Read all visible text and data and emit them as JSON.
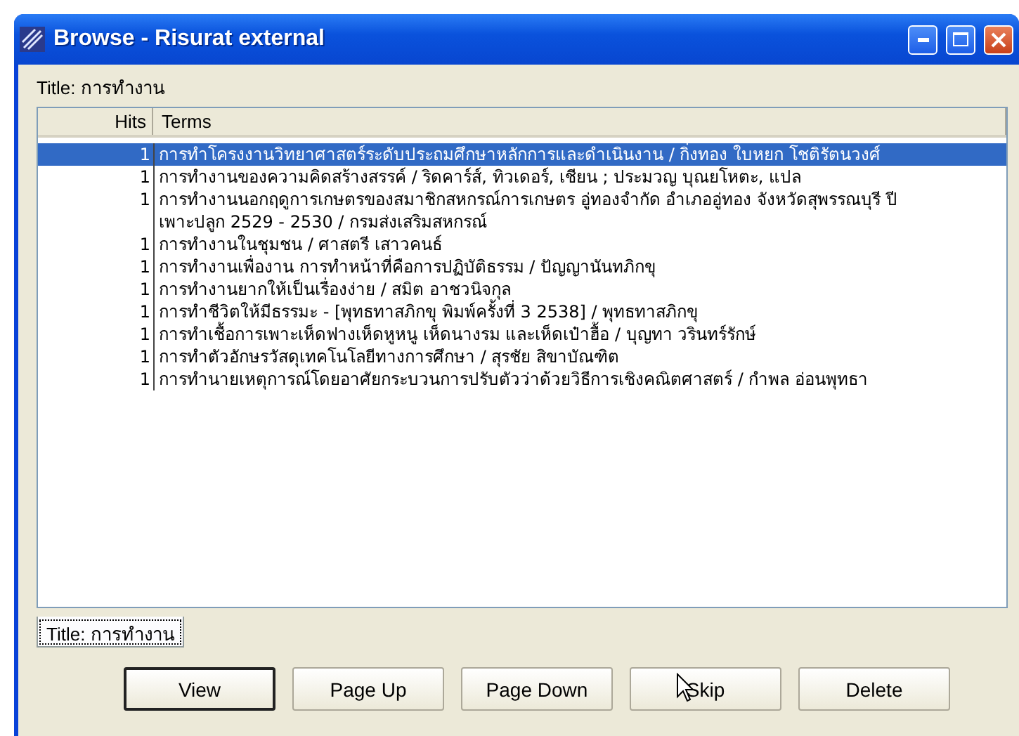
{
  "window": {
    "title": "Browse - Risurat external"
  },
  "query_label": "Title: การทำงาน",
  "table": {
    "columns": [
      "Hits",
      "Terms"
    ],
    "rows": [
      {
        "hits": "1",
        "term": "การทำโครงงานวิทยาศาสตร์ระดับประถมศึกษาหลักการและดำเนินงาน / กิ่งทอง ใบหยก โชติรัตนวงศ์",
        "selected": true
      },
      {
        "hits": "1",
        "term": "การทำงานของความคิดสร้างสรรค์ / ริดคาร์ส์, ทิวเดอร์, เชียน ; ประมวญ บุณยโหตะ, แปล",
        "selected": false
      },
      {
        "hits": "1",
        "term": "การทำงานนอกฤดูการเกษตรของสมาชิกสหกรณ์การเกษตร อู่ทองจำกัด อำเภออู่ทอง จังหวัดสุพรรณบุรี ปีเพาะปลูก 2529 - 2530 / กรมส่งเสริมสหกรณ์",
        "selected": false
      },
      {
        "hits": "1",
        "term": "การทำงานในชุมชน / ศาสตรี เสาวคนธ์",
        "selected": false
      },
      {
        "hits": "1",
        "term": "การทำงานเพื่องาน การทำหน้าที่คือการปฏิบัติธรรม / ปัญญานันทภิกขุ",
        "selected": false
      },
      {
        "hits": "1",
        "term": "การทำงานยากให้เป็นเรื่องง่าย / สมิต อาชวนิจกุล",
        "selected": false
      },
      {
        "hits": "1",
        "term": "การทำชีวิตให้มีธรรมะ - [พุทธทาสภิกขุ พิมพ์ครั้งที่ 3 2538] / พุทธทาสภิกขุ",
        "selected": false
      },
      {
        "hits": "1",
        "term": "การทำเชื้อการเพาะเห็ดฟางเห็ดหูหนู เห็ดนางรม และเห็ดเป๋าฮื้อ / บุญทา วรินทร์รักษ์",
        "selected": false
      },
      {
        "hits": "1",
        "term": "การทำตัวอักษรวัสดุเทคโนโลยีทางการศึกษา / สุรชัย สิขาบัณฑิต",
        "selected": false
      },
      {
        "hits": "1",
        "term": "การทำนายเหตุการณ์โดยอาศัยกระบวนการปรับตัวว่าด้วยวิธีการเชิงคณิตศาสตร์ / กำพล อ่อนพุทธา",
        "selected": false
      }
    ]
  },
  "tabs": [
    {
      "label": "Title: การทำงาน",
      "selected": true
    }
  ],
  "buttons": [
    {
      "label": "View",
      "default": true
    },
    {
      "label": "Page Up",
      "default": false
    },
    {
      "label": "Page Down",
      "default": false
    },
    {
      "label": "Skip",
      "default": false
    },
    {
      "label": "Delete",
      "default": false
    }
  ]
}
